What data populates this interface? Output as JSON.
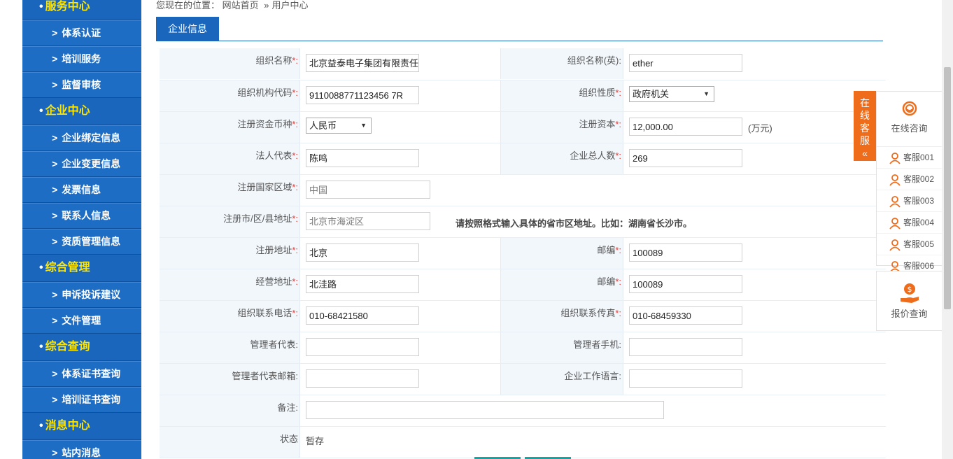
{
  "sidebar": {
    "sections": [
      {
        "title": "服务中心",
        "items": [
          "体系认证",
          "培训服务",
          "监督审核"
        ]
      },
      {
        "title": "企业中心",
        "items": [
          "企业绑定信息",
          "企业变更信息",
          "发票信息",
          "联系人信息",
          "资质管理信息"
        ]
      },
      {
        "title": "综合管理",
        "items": [
          "申诉投诉建议",
          "文件管理"
        ]
      },
      {
        "title": "综合查询",
        "items": [
          "体系证书查询",
          "培训证书查询"
        ]
      },
      {
        "title": "消息中心",
        "items": [
          "站内消息"
        ]
      }
    ]
  },
  "breadcrumb": {
    "prefix": "您现在的位置：",
    "home": "网站首页",
    "separator": "»",
    "current": "用户中心"
  },
  "tabs": {
    "active": "企业信息"
  },
  "form": {
    "org_name_label": "组织名称",
    "org_name_value": "北京益泰电子集团有限责任",
    "org_name_en_label": "组织名称(英):",
    "org_name_en_value": "ether",
    "org_code_label": "组织机构代码",
    "org_code_value": "9110088771123456 7R",
    "org_nature_label": "组织性质",
    "org_nature_value": "政府机关",
    "currency_label": "注册资金币种",
    "currency_value": "人民币",
    "capital_label": "注册资本",
    "capital_value": "12,000.00",
    "capital_unit": "(万元)",
    "legal_rep_label": "法人代表",
    "legal_rep_value": "陈鸣",
    "staff_label": "企业总人数",
    "staff_value": "269",
    "country_label": "注册国家区域",
    "country_value": "中国",
    "city_label": "注册市/区/县地址",
    "city_value": "北京市海淀区",
    "city_hint": "请按照格式输入具体的省市区地址。比如：湖南省长沙市。",
    "reg_addr_label": "注册地址",
    "reg_addr_value": "北京",
    "postcode1_label": "邮编",
    "postcode1_value": "100089",
    "biz_addr_label": "经营地址",
    "biz_addr_value": "北洼路",
    "postcode2_label": "邮编",
    "postcode2_value": "100089",
    "phone_label": "组织联系电话",
    "phone_value": "010-68421580",
    "fax_label": "组织联系传真",
    "fax_value": "010-68459330",
    "manager_label": "管理者代表:",
    "manager_value": "",
    "manager_mobile_label": "管理者手机:",
    "manager_mobile_value": "",
    "manager_email_label": "管理者代表邮箱:",
    "manager_email_value": "",
    "work_lang_label": "企业工作语言:",
    "work_lang_value": "",
    "remark_label": "备注:",
    "remark_value": "",
    "status_label": "状态",
    "status_value": "暂存",
    "required_mark": "*:"
  },
  "service": {
    "tab_label": [
      "在",
      "线",
      "客",
      "服",
      "«"
    ],
    "online_label": "在线咨询",
    "agents": [
      "客服001",
      "客服002",
      "客服003",
      "客服004",
      "客服005",
      "客服006"
    ],
    "quote_label": "报价查询",
    "accent": "#ef6c1a"
  },
  "colors": {
    "sidebar": "#1a66bd",
    "section_title": "#ffe600",
    "required": "#e53935"
  }
}
